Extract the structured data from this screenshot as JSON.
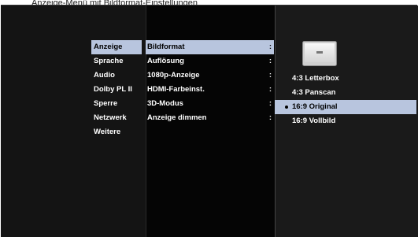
{
  "caption": "Anzeige-Menü mit Bildformat-Einstellungen",
  "menu": {
    "items": [
      {
        "label": "Anzeige",
        "selected": true
      },
      {
        "label": "Sprache",
        "selected": false
      },
      {
        "label": "Audio",
        "selected": false
      },
      {
        "label": "Dolby PL II",
        "selected": false
      },
      {
        "label": "Sperre",
        "selected": false
      },
      {
        "label": "Netzwerk",
        "selected": false
      },
      {
        "label": "Weitere",
        "selected": false
      }
    ]
  },
  "settings": {
    "rows": [
      {
        "label": "Bildformat",
        "selected": true
      },
      {
        "label": "Auflösung",
        "selected": false
      },
      {
        "label": "1080p-Anzeige",
        "selected": false
      },
      {
        "label": "HDMI-Farbeinst.",
        "selected": false
      },
      {
        "label": "3D-Modus",
        "selected": false
      },
      {
        "label": "Anzeige dimmen",
        "selected": false
      }
    ],
    "separator": ":"
  },
  "options": {
    "icon": "tv-screen-icon",
    "items": [
      {
        "label": "4:3 Letterbox",
        "selected": false
      },
      {
        "label": "4:3 Panscan",
        "selected": false
      },
      {
        "label": "16:9 Original",
        "selected": true
      },
      {
        "label": "16:9 Vollbild",
        "selected": false
      }
    ]
  },
  "colors": {
    "highlight": "#b8c5de",
    "background": "#050505"
  }
}
